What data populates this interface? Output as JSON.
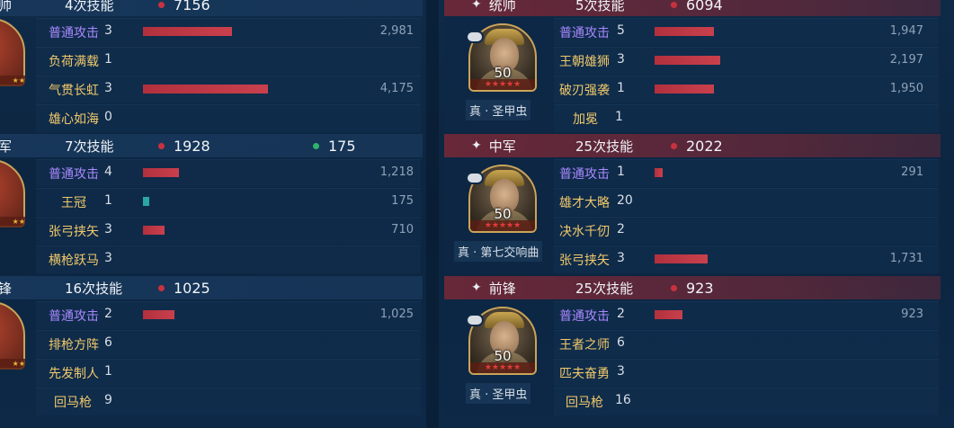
{
  "left_panel": {
    "groups": [
      {
        "role": "帅",
        "skill_count": "4次技能",
        "damage": "7156",
        "heal": "",
        "rows": [
          {
            "name": "普通攻击",
            "count": "3",
            "value": "2,981",
            "bar_fraction": 0.42,
            "purple": true
          },
          {
            "name": "负荷满载",
            "count": "1",
            "value": "",
            "bar_fraction": 0,
            "purple": false
          },
          {
            "name": "气贯长虹",
            "count": "3",
            "value": "4,175",
            "bar_fraction": 0.59,
            "purple": false
          },
          {
            "name": "雄心如海",
            "count": "0",
            "value": "",
            "bar_fraction": 0,
            "purple": false
          }
        ]
      },
      {
        "role": "军",
        "skill_count": "7次技能",
        "damage": "1928",
        "heal": "175",
        "rows": [
          {
            "name": "普通攻击",
            "count": "4",
            "value": "1,218",
            "bar_fraction": 0.17,
            "purple": true
          },
          {
            "name": "王冠",
            "count": "1",
            "value": "175",
            "bar_fraction": 0.03,
            "purple": false,
            "teal": true
          },
          {
            "name": "张弓挟矢",
            "count": "3",
            "value": "710",
            "bar_fraction": 0.1,
            "purple": false
          },
          {
            "name": "横枪跃马",
            "count": "3",
            "value": "",
            "bar_fraction": 0,
            "purple": false
          }
        ]
      },
      {
        "role": "锋",
        "skill_count": "16次技能",
        "damage": "1025",
        "heal": "",
        "rows": [
          {
            "name": "普通攻击",
            "count": "2",
            "value": "1,025",
            "bar_fraction": 0.15,
            "purple": true
          },
          {
            "name": "排枪方阵",
            "count": "6",
            "value": "",
            "bar_fraction": 0,
            "purple": false
          },
          {
            "name": "先发制人",
            "count": "1",
            "value": "",
            "bar_fraction": 0,
            "purple": false
          },
          {
            "name": "回马枪",
            "count": "9",
            "value": "",
            "bar_fraction": 0,
            "purple": false
          }
        ]
      }
    ]
  },
  "right_panel": {
    "groups": [
      {
        "role": "统帅",
        "skill_count": "5次技能",
        "damage": "6094",
        "general_name": "真 · 圣甲虫",
        "level": "50",
        "stars": "★★★★★",
        "rows": [
          {
            "name": "普通攻击",
            "count": "5",
            "value": "1,947",
            "bar_fraction": 0.28,
            "purple": true
          },
          {
            "name": "王朝雄狮",
            "count": "3",
            "value": "2,197",
            "bar_fraction": 0.31,
            "purple": false
          },
          {
            "name": "破刃强袭",
            "count": "1",
            "value": "1,950",
            "bar_fraction": 0.28,
            "purple": false
          },
          {
            "name": "加冕",
            "count": "1",
            "value": "",
            "bar_fraction": 0,
            "purple": false
          }
        ]
      },
      {
        "role": "中军",
        "skill_count": "25次技能",
        "damage": "2022",
        "general_name": "真 · 第七交响曲",
        "level": "50",
        "stars": "★★★★★",
        "rows": [
          {
            "name": "普通攻击",
            "count": "1",
            "value": "291",
            "bar_fraction": 0.04,
            "purple": true
          },
          {
            "name": "雄才大略",
            "count": "20",
            "value": "",
            "bar_fraction": 0,
            "purple": false
          },
          {
            "name": "决水千仞",
            "count": "2",
            "value": "",
            "bar_fraction": 0,
            "purple": false
          },
          {
            "name": "张弓挟矢",
            "count": "3",
            "value": "1,731",
            "bar_fraction": 0.25,
            "purple": false
          }
        ]
      },
      {
        "role": "前锋",
        "skill_count": "25次技能",
        "damage": "923",
        "general_name": "真 · 圣甲虫",
        "level": "50",
        "stars": "★★★★★",
        "rows": [
          {
            "name": "普通攻击",
            "count": "2",
            "value": "923",
            "bar_fraction": 0.13,
            "purple": true
          },
          {
            "name": "王者之师",
            "count": "6",
            "value": "",
            "bar_fraction": 0,
            "purple": false
          },
          {
            "name": "匹夫奋勇",
            "count": "3",
            "value": "",
            "bar_fraction": 0,
            "purple": false
          },
          {
            "name": "回马枪",
            "count": "16",
            "value": "",
            "bar_fraction": 0,
            "purple": false
          }
        ]
      }
    ]
  },
  "colors": {
    "damage_bar": "#c03845",
    "heal_bar": "#2aa6a6",
    "skill_name_gold": "#f1c96a",
    "skill_name_purple": "#a989ff"
  },
  "icons": {
    "header_mark": "four-point-star-icon",
    "damage_dot": "red-dot-icon",
    "heal_dot": "green-dot-icon"
  }
}
